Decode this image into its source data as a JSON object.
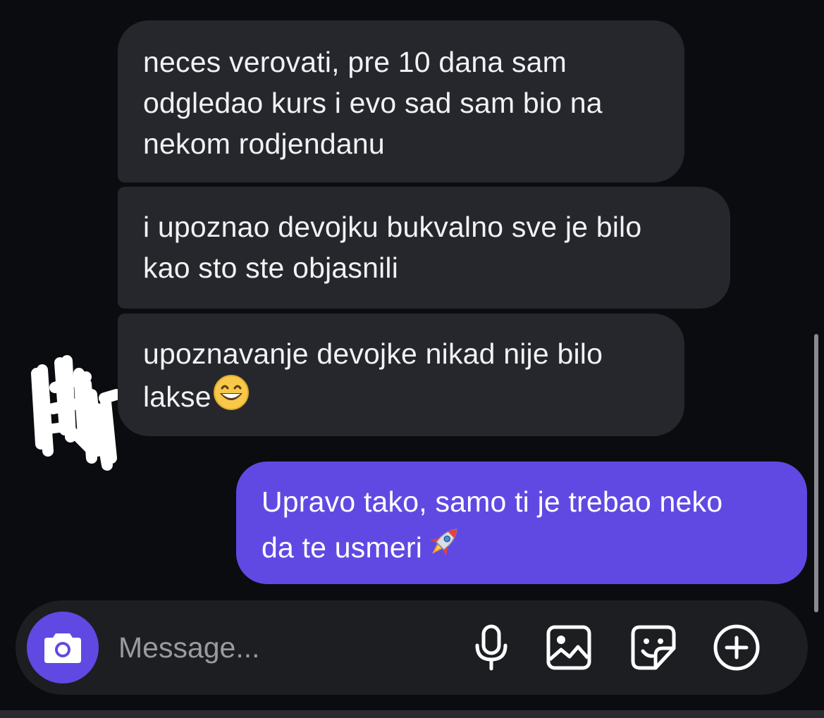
{
  "conversation": {
    "messages": [
      {
        "sender": "other",
        "text": "neces verovati, pre 10 dana sam\nodgledao kurs i evo sad sam bio na\nnekom rodjendanu",
        "emoji": ""
      },
      {
        "sender": "other",
        "text": "i upoznao devojku bukvalno sve je bilo\nkao sto ste objasnili",
        "emoji": ""
      },
      {
        "sender": "other",
        "text": "upoznavanje devojke nikad nije bilo\nlakse",
        "emoji": "grinning-face-with-smiling-eyes"
      },
      {
        "sender": "me",
        "text": "Upravo tako, samo ti je trebao neko\nda te usmeri",
        "emoji": "rocket"
      }
    ]
  },
  "composer": {
    "placeholder": "Message...",
    "icons": [
      "camera-icon",
      "microphone-icon",
      "gallery-icon",
      "sticker-icon",
      "plus-icon"
    ]
  },
  "colors": {
    "background": "#0b0c10",
    "received_bubble": "#26272c",
    "sent_bubble": "#6049e3",
    "composer": "#1d1e22"
  }
}
